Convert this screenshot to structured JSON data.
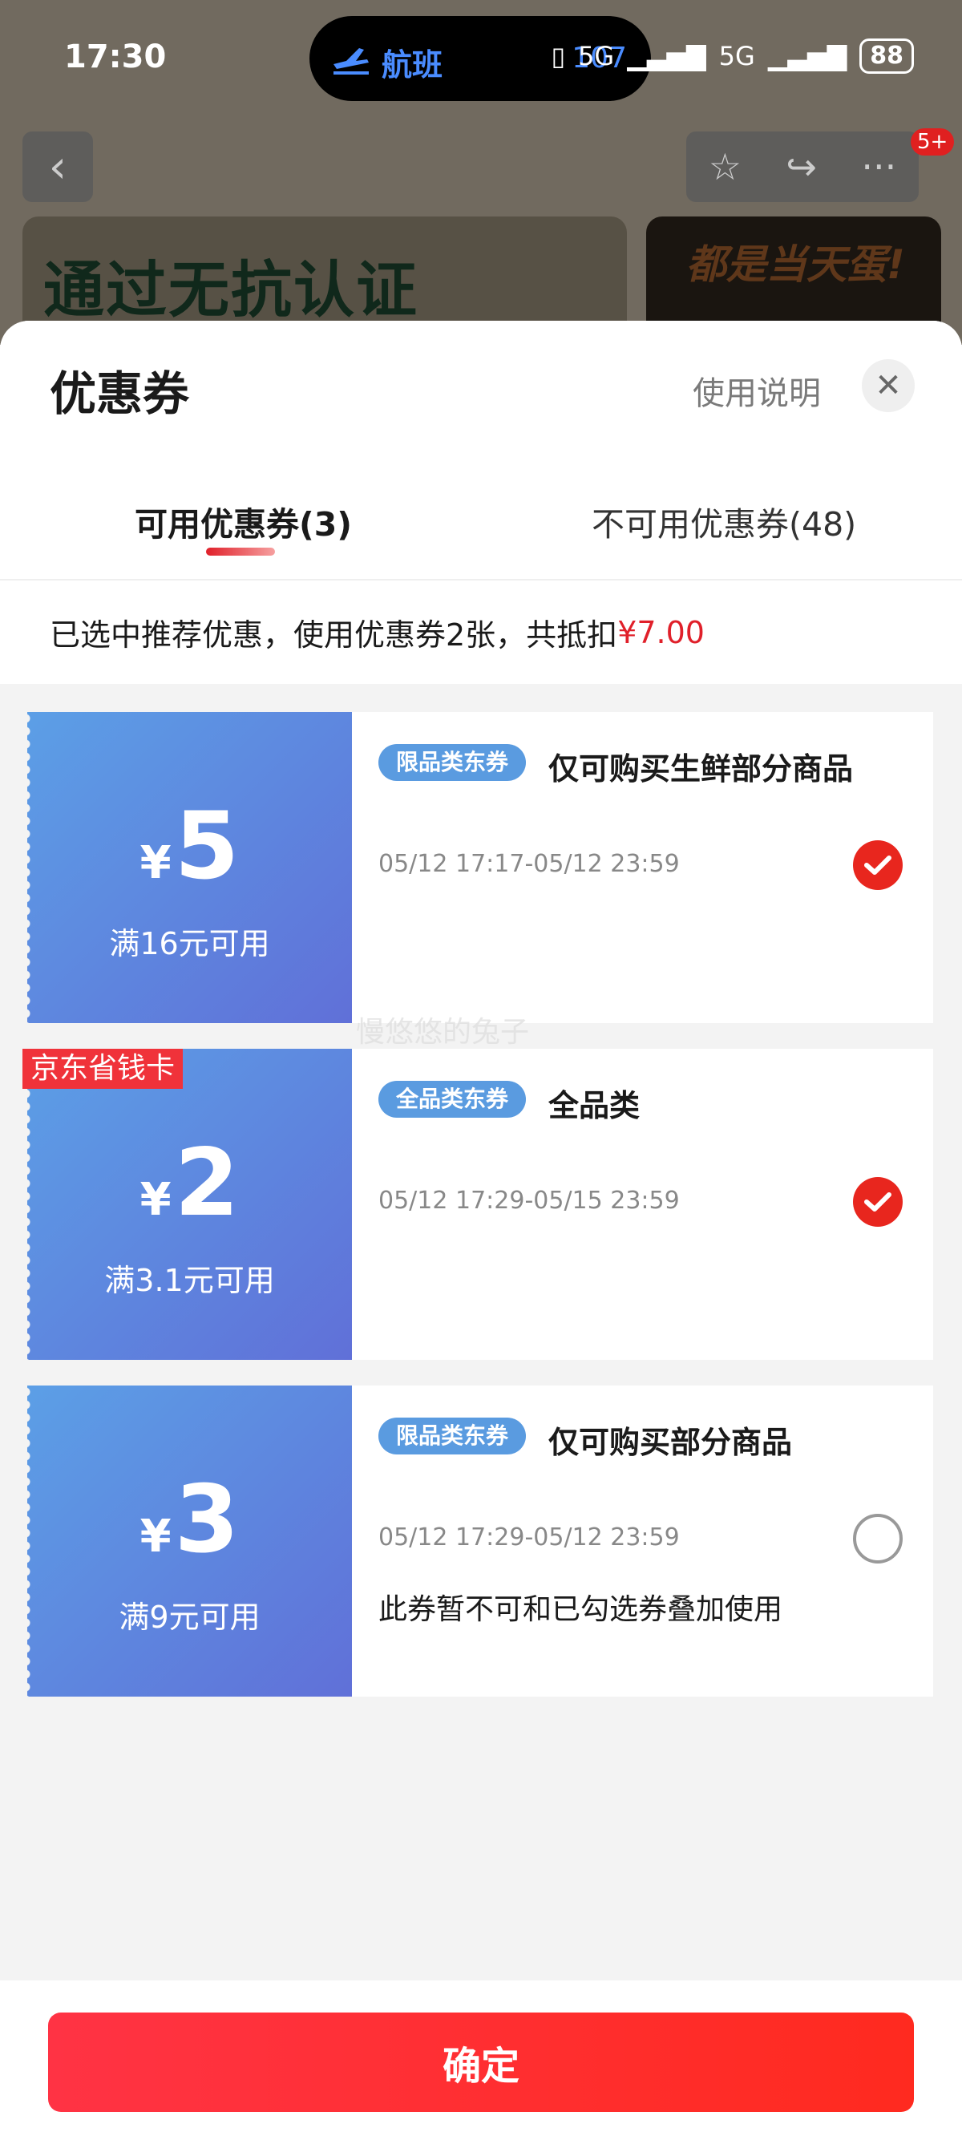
{
  "statusbar": {
    "time": "17:30",
    "island_label": "航班",
    "island_number": "107",
    "signal_1": "5G",
    "signal_2": "5G",
    "battery": "88"
  },
  "background": {
    "badge": "5+",
    "banner1_text": "通过无抗认证",
    "banner2_text": "都是当天蛋!"
  },
  "sheet": {
    "title": "优惠券",
    "help_label": "使用说明",
    "tabs": [
      {
        "label": "可用优惠券(3)"
      },
      {
        "label": "不可用优惠券(48)"
      }
    ],
    "summary_text": "已选中推荐优惠，使用优惠券2张，共抵扣",
    "summary_amount": "¥7.00"
  },
  "coupons": [
    {
      "yen": "¥",
      "amount": "5",
      "condition": "满16元可用",
      "tag": "限品类东券",
      "name": "仅可购买生鲜部分商品",
      "date": "05/12 17:17-05/12 23:59",
      "selected": true
    },
    {
      "ribbon": "京东省钱卡",
      "yen": "¥",
      "amount": "2",
      "condition": "满3.1元可用",
      "tag": "全品类东券",
      "name": "全品类",
      "date": "05/12 17:29-05/15 23:59",
      "selected": true
    },
    {
      "yen": "¥",
      "amount": "3",
      "condition": "满9元可用",
      "tag": "限品类东券",
      "name": "仅可购买部分商品",
      "date": "05/12 17:29-05/12 23:59",
      "note": "此券暂不可和已勾选券叠加使用",
      "selected": false
    }
  ],
  "watermark": "慢悠悠的兔子",
  "footer": {
    "confirm_label": "确定"
  },
  "colors": {
    "accent": "#e8261e",
    "coupon_blue": "#5c9fe6",
    "tag_blue": "#5a9be0"
  }
}
